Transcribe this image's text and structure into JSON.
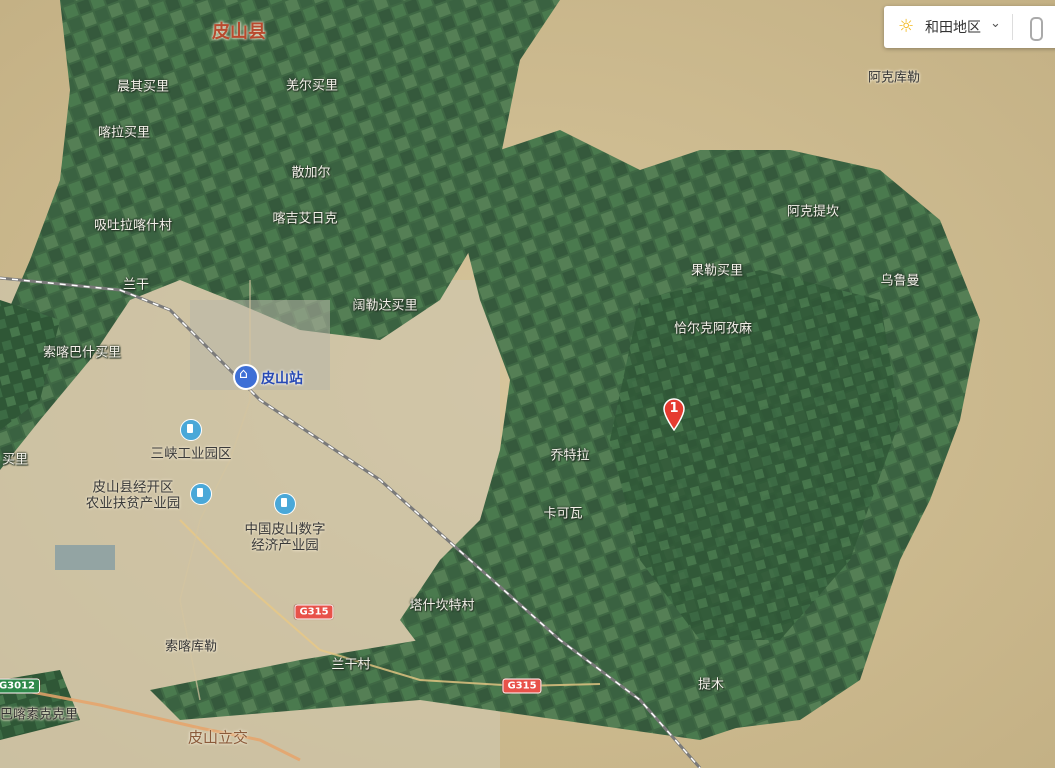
{
  "region_selector": {
    "weather_icon": "sun-icon",
    "region": "和田地区",
    "chevron": "⌄",
    "traffic_icon": "traffic-light-icon"
  },
  "map": {
    "county_label": "皮山县",
    "places": [
      {
        "name": "晨其买里"
      },
      {
        "name": "羌尔买里"
      },
      {
        "name": "喀拉买里"
      },
      {
        "name": "散加尔"
      },
      {
        "name": "喀吉艾日克"
      },
      {
        "name": "吸吐拉喀什村"
      },
      {
        "name": "兰干"
      },
      {
        "name": "阿克库勒"
      },
      {
        "name": "阿克提坎"
      },
      {
        "name": "果勒买里"
      },
      {
        "name": "乌鲁曼"
      },
      {
        "name": "阔勒达买里"
      },
      {
        "name": "恰尔克阿孜麻"
      },
      {
        "name": "索喀巴什买里"
      },
      {
        "name": "乔特拉"
      },
      {
        "name": "卡可瓦"
      },
      {
        "name": "塔什坎特村"
      },
      {
        "name": "兰干村"
      },
      {
        "name": "提木"
      },
      {
        "name": "索喀库勒"
      },
      {
        "name": "买里"
      },
      {
        "name": "巴喀素克克里"
      }
    ],
    "station": "皮山站",
    "pois": [
      {
        "name": "三峡工业园区"
      },
      {
        "name": "皮山县经开区\n农业扶贫产业园"
      },
      {
        "name": "中国皮山数字\n经济产业园"
      }
    ],
    "interchange": "皮山立交",
    "shields": {
      "g315_a": "G315",
      "g315_b": "G315",
      "g3012": "G3012"
    },
    "marker": "1"
  }
}
